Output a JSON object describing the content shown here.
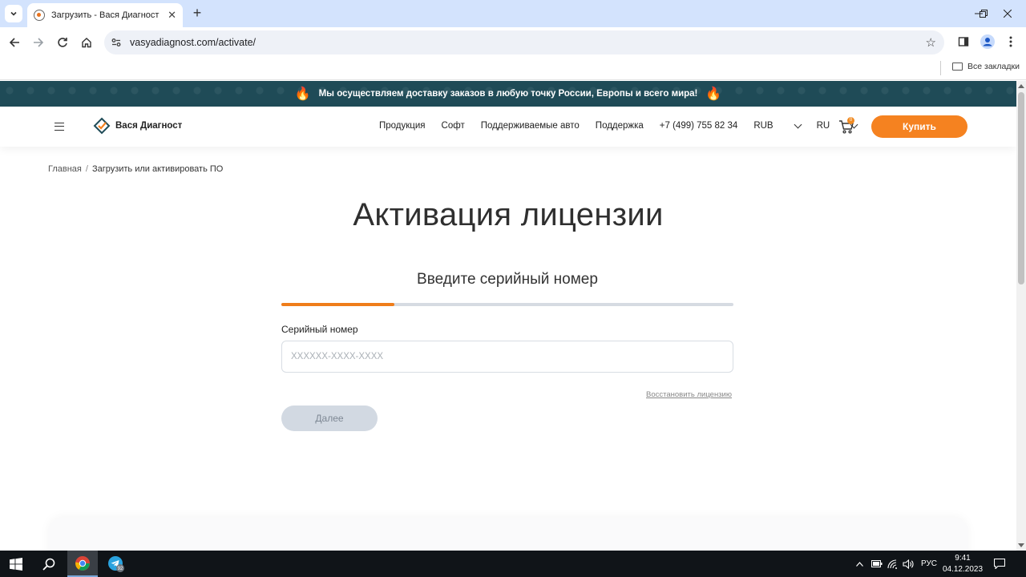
{
  "browser": {
    "tab_title": "Загрузить - Вася Диагност",
    "url": "vasyadiagnost.com/activate/",
    "bookmarks_label": "Все закладки"
  },
  "promo": {
    "text": "Мы осуществляем доставку заказов в любую точку России, Европы и всего мира!",
    "icon_left": "🔥",
    "icon_right": "🔥"
  },
  "header": {
    "logo_text": "Вася Диагност",
    "nav": [
      "Продукция",
      "Софт",
      "Поддерживаемые авто",
      "Поддержка"
    ],
    "phone": "+7 (499) 755 82 34",
    "currency": "RUB",
    "language": "RU",
    "cart_count": "0",
    "buy_label": "Купить"
  },
  "breadcrumb": {
    "home": "Главная",
    "separator": "/",
    "current": "Загрузить или активировать ПО"
  },
  "main": {
    "title": "Активация лицензии",
    "step_title": "Введите серийный номер",
    "progress_fraction": 0.25,
    "field_label": "Серийный номер",
    "field_placeholder": "XXXXXX-XXXX-XXXX",
    "field_value": "",
    "restore_link": "Восстановить лицензию",
    "next_label": "Далее"
  },
  "taskbar": {
    "telegram_badge": "92",
    "language": "РУС",
    "time": "9:41",
    "date": "04.12.2023"
  },
  "colors": {
    "accent_orange": "#f58220",
    "promo_bg": "#1f4b57",
    "progress_fill": "#ef7d1a",
    "button_disabled": "#d2d9e2"
  }
}
